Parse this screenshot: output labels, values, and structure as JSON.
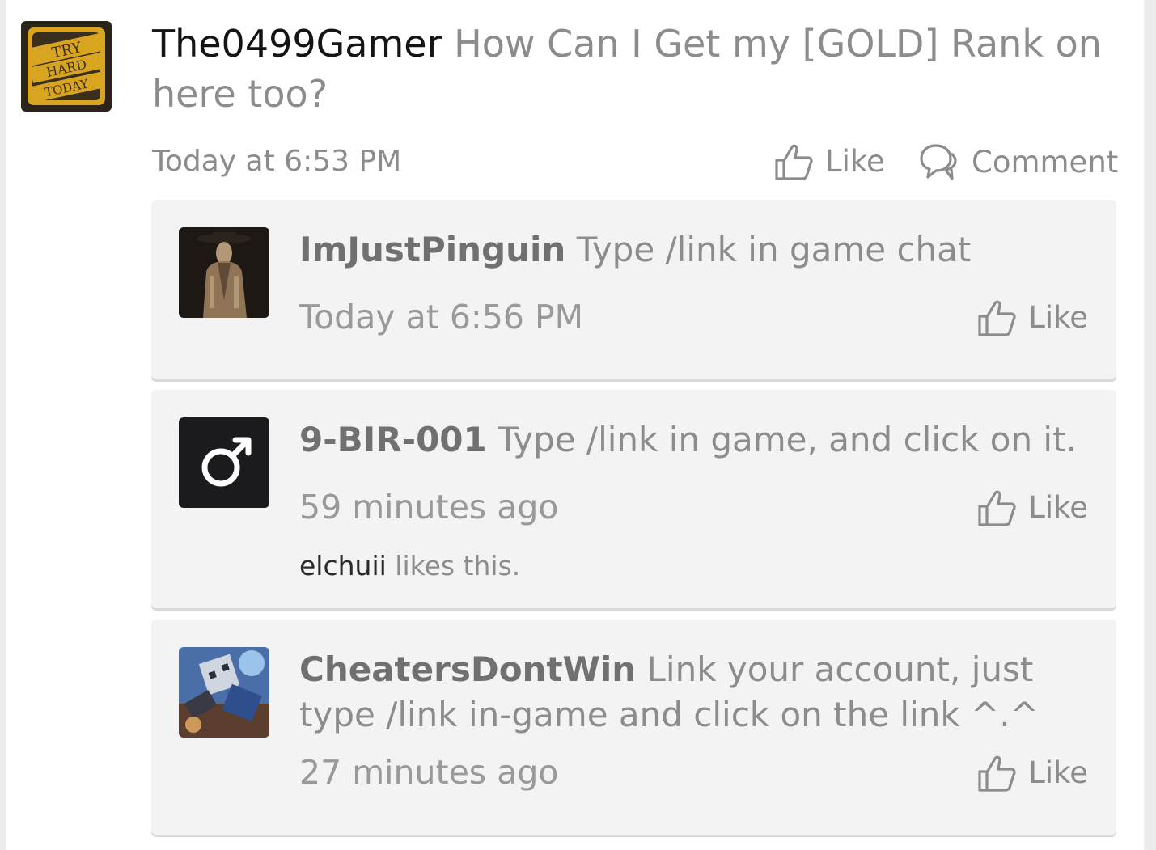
{
  "post": {
    "author": "The0499Gamer",
    "text": "How Can I Get my [GOLD] Rank on here too?",
    "time": "Today at 6:53 PM",
    "like_label": "Like",
    "comment_label": "Comment",
    "avatar_text": [
      "TRY",
      "HARD",
      "TODAY"
    ]
  },
  "comments": [
    {
      "author": "ImJustPinguin",
      "text": "Type /link in game chat",
      "time": "Today at 6:56 PM",
      "like_label": "Like"
    },
    {
      "author": "9-BIR-001",
      "text": "Type /link in game, and click on it.",
      "time": "59 minutes ago",
      "like_label": "Like",
      "liked_by": "elchuii",
      "likes_suffix": "likes this."
    },
    {
      "author": "CheatersDontWin",
      "text": "Link your account, just type /link in-game and click on the link ^.^",
      "time": "27 minutes ago",
      "like_label": "Like"
    }
  ],
  "icons": {
    "like": "thumbs-up-icon",
    "comment": "speech-bubbles-icon",
    "male": "male-symbol-icon"
  },
  "colors": {
    "author_dark": "#141414",
    "meta_gray": "#8c8c8c",
    "card_bg": "#f3f3f3",
    "badge_gold": "#d9a520"
  }
}
